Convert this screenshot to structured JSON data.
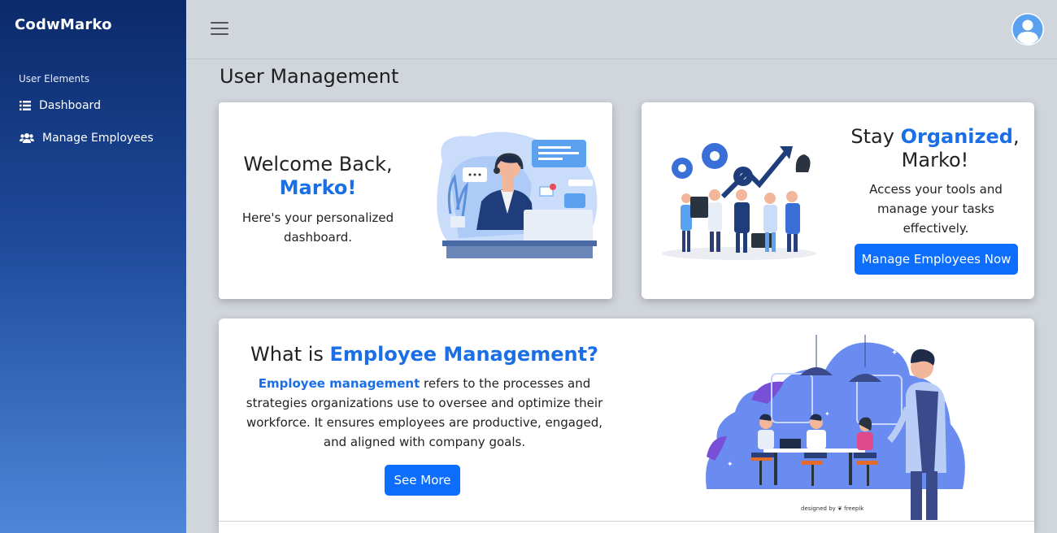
{
  "app": {
    "brand": "CodwMarko"
  },
  "sidebar": {
    "section_label": "User Elements",
    "items": [
      {
        "label": "Dashboard",
        "icon": "list-icon"
      },
      {
        "label": "Manage Employees",
        "icon": "users-icon"
      }
    ]
  },
  "header": {
    "menu_icon": "hamburger-icon",
    "avatar_icon": "user-avatar-icon"
  },
  "page": {
    "title": "User Management"
  },
  "welcome_card": {
    "title": "Welcome Back,",
    "name": "Marko!",
    "subtitle": "Here's your personalized dashboard."
  },
  "organized_card": {
    "title_prefix": "Stay ",
    "title_highlight": "Organized",
    "title_suffix": ",",
    "title_line2": "Marko!",
    "subtitle": "Access your tools and manage your tasks effectively.",
    "button_label": "Manage Employees Now"
  },
  "info_card": {
    "title_prefix": "What is ",
    "title_highlight": "Employee Management?",
    "desc_highlight": "Employee management",
    "desc_rest": " refers to the processes and strategies organizations use to oversee and optimize their workforce. It ensures employees are productive, engaged, and aligned with company goals.",
    "button_label": "See More",
    "credit": "designed by ❦ freepik"
  },
  "colors": {
    "accent": "#1a6ee6",
    "button": "#0d6efd",
    "sidebar_top": "#0b2a6b",
    "sidebar_bottom": "#4f86d8",
    "page_bg": "#d1d5dc"
  }
}
